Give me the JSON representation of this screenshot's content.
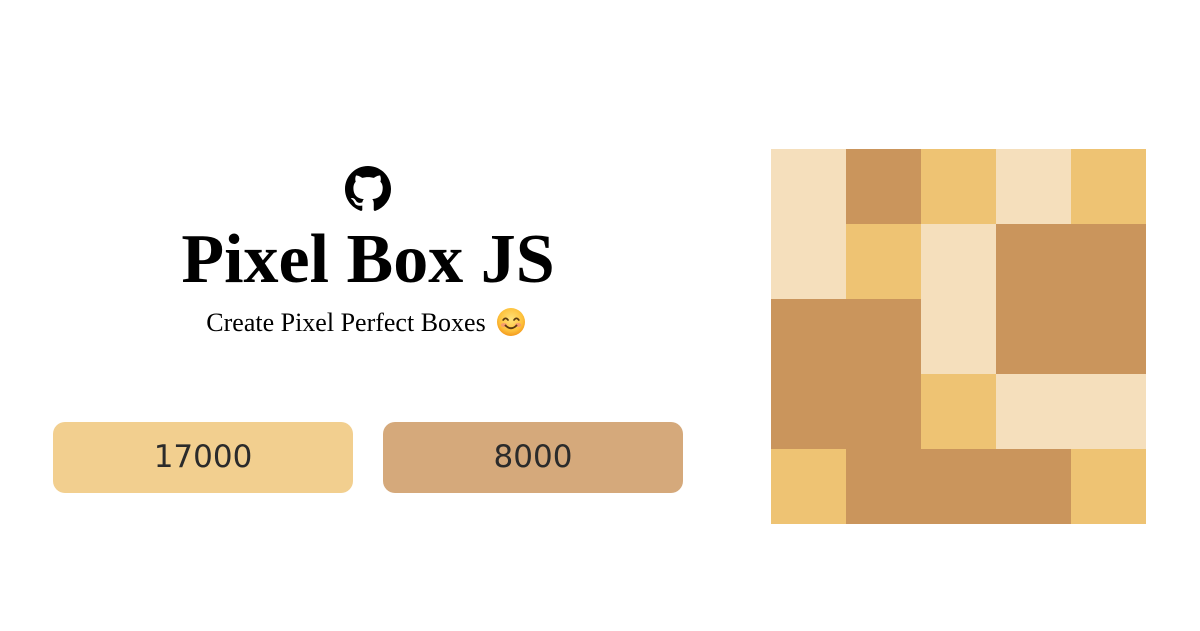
{
  "header": {
    "github_icon": "github-icon",
    "title": "Pixel Box JS",
    "subtitle": "Create Pixel Perfect Boxes",
    "subtitle_emoji": "smiling-face-icon"
  },
  "buttons": [
    {
      "label": "17000",
      "color": "#F2CF8F"
    },
    {
      "label": "8000",
      "color": "#D5A97B"
    }
  ],
  "colors": {
    "light": "#F5DFBC",
    "mid": "#EEC373",
    "dark": "#CA955C"
  },
  "pixel_box": {
    "rows": 5,
    "cols": 5,
    "blocks": [
      {
        "row": 0,
        "col": 0,
        "rowspan": 2,
        "colspan": 1,
        "tone": "light"
      },
      {
        "row": 0,
        "col": 1,
        "rowspan": 1,
        "colspan": 1,
        "tone": "dark"
      },
      {
        "row": 0,
        "col": 2,
        "rowspan": 1,
        "colspan": 1,
        "tone": "mid"
      },
      {
        "row": 0,
        "col": 3,
        "rowspan": 1,
        "colspan": 1,
        "tone": "light"
      },
      {
        "row": 0,
        "col": 4,
        "rowspan": 1,
        "colspan": 1,
        "tone": "mid"
      },
      {
        "row": 1,
        "col": 1,
        "rowspan": 1,
        "colspan": 1,
        "tone": "mid"
      },
      {
        "row": 1,
        "col": 2,
        "rowspan": 2,
        "colspan": 1,
        "tone": "light"
      },
      {
        "row": 1,
        "col": 3,
        "rowspan": 2,
        "colspan": 2,
        "tone": "dark"
      },
      {
        "row": 2,
        "col": 0,
        "rowspan": 2,
        "colspan": 2,
        "tone": "dark"
      },
      {
        "row": 3,
        "col": 2,
        "rowspan": 1,
        "colspan": 1,
        "tone": "mid"
      },
      {
        "row": 3,
        "col": 3,
        "rowspan": 1,
        "colspan": 2,
        "tone": "light"
      },
      {
        "row": 4,
        "col": 0,
        "rowspan": 1,
        "colspan": 1,
        "tone": "mid"
      },
      {
        "row": 4,
        "col": 1,
        "rowspan": 1,
        "colspan": 3,
        "tone": "dark"
      },
      {
        "row": 4,
        "col": 4,
        "rowspan": 1,
        "colspan": 1,
        "tone": "mid"
      }
    ]
  }
}
